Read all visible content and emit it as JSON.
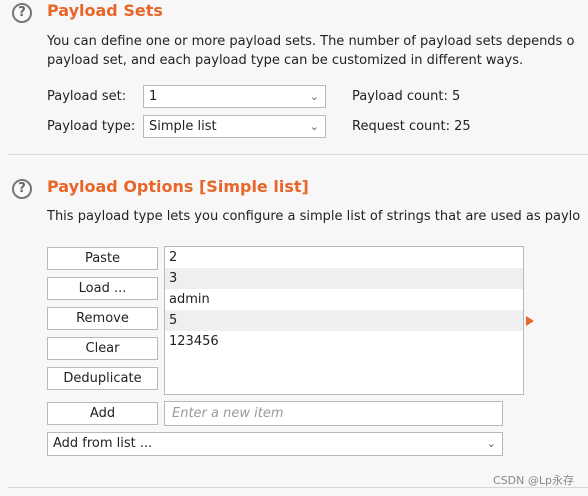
{
  "payload_sets": {
    "title": "Payload Sets",
    "desc_line1": "You can define one or more payload sets. The number of payload sets depends o",
    "desc_line2": "payload set, and each payload type can be customized in different ways.",
    "set_label": "Payload set:",
    "set_value": "1",
    "type_label": "Payload type:",
    "type_value": "Simple list",
    "payload_count": "Payload count: 5",
    "request_count": "Request count: 25"
  },
  "payload_options": {
    "title": "Payload Options [Simple list]",
    "desc": "This payload type lets you configure a simple list of strings that are used as paylo",
    "buttons": {
      "paste": "Paste",
      "load": "Load ...",
      "remove": "Remove",
      "clear": "Clear",
      "deduplicate": "Deduplicate",
      "add": "Add"
    },
    "items": [
      "2",
      "3",
      "admin",
      "5",
      "123456"
    ],
    "new_item_placeholder": "Enter a new item",
    "add_from_list": "Add from list ..."
  },
  "icons": {
    "help": "help-icon",
    "dropdown": "chevron-down-icon",
    "arrow": "arrow-right-icon"
  },
  "colors": {
    "accent": "#e8662a"
  },
  "watermark": "CSDN @Lp永存"
}
